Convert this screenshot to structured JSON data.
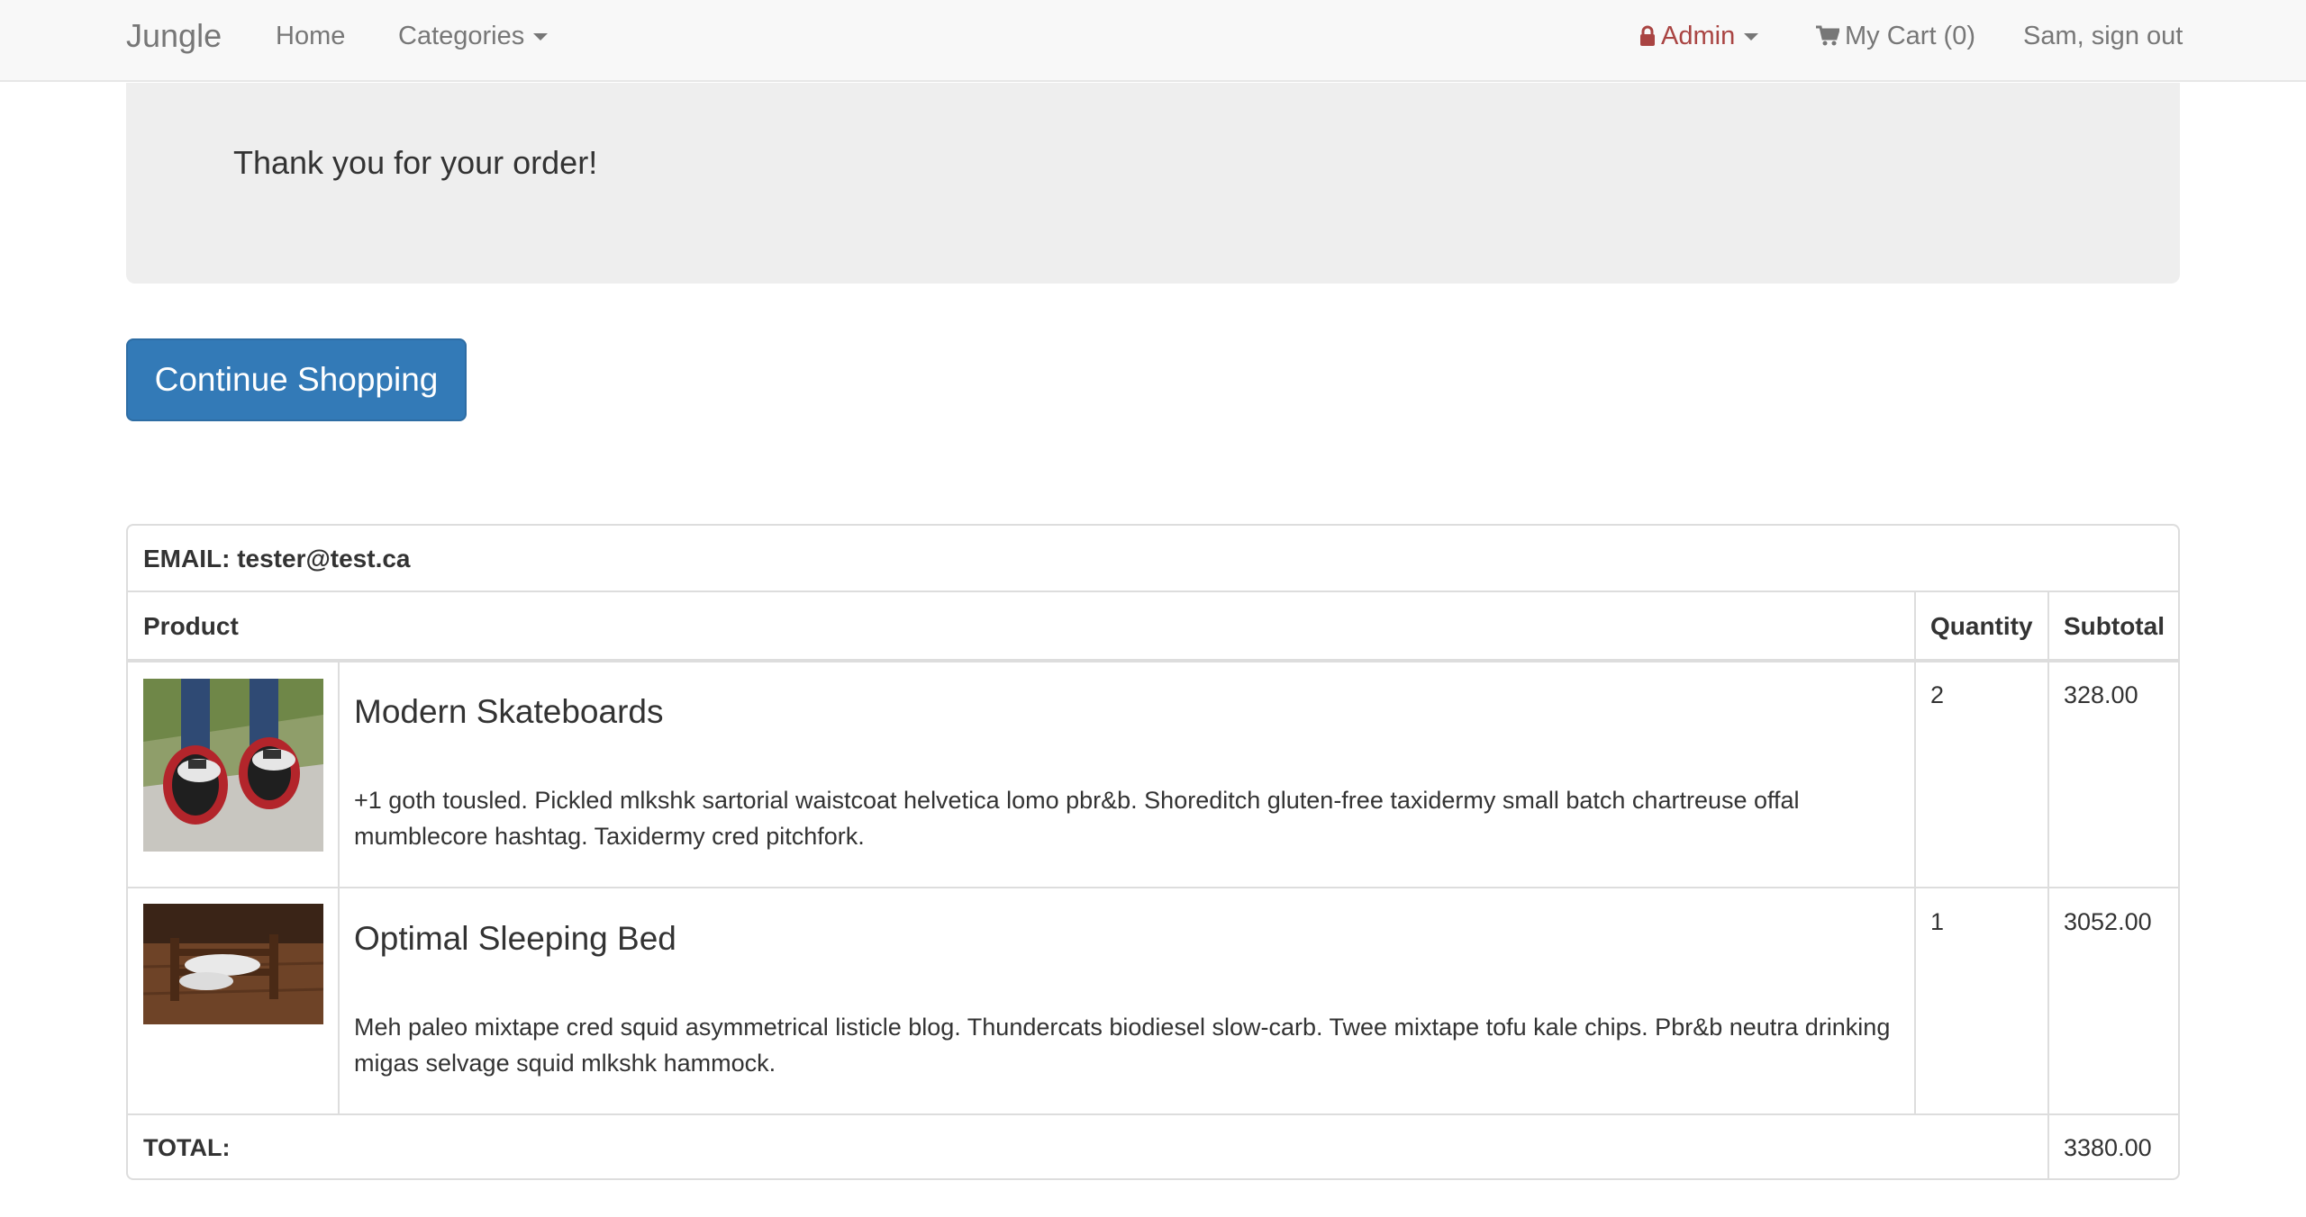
{
  "navbar": {
    "brand": "Jungle",
    "home": "Home",
    "categories": "Categories",
    "admin": "Admin",
    "cart": "My Cart (0)",
    "signout": "Sam, sign out"
  },
  "jumbotron": {
    "title": "Thank you for your order!"
  },
  "continue_button": "Continue Shopping",
  "order": {
    "email_label": "EMAIL: tester@test.ca",
    "headers": {
      "product": "Product",
      "quantity": "Quantity",
      "subtotal": "Subtotal"
    },
    "items": [
      {
        "name": "Modern Skateboards",
        "description": "+1 goth tousled. Pickled mlkshk sartorial waistcoat helvetica lomo pbr&b. Shoreditch gluten-free taxidermy small batch chartreuse offal mumblecore hashtag. Taxidermy cred pitchfork.",
        "quantity": "2",
        "subtotal": "328.00"
      },
      {
        "name": "Optimal Sleeping Bed",
        "description": "Meh paleo mixtape cred squid asymmetrical listicle blog. Thundercats biodiesel slow-carb. Twee mixtape tofu kale chips. Pbr&b neutra drinking migas selvage squid mlkshk hammock.",
        "quantity": "1",
        "subtotal": "3052.00"
      }
    ],
    "total_label": "TOTAL:",
    "total_value": "3380.00"
  },
  "colors": {
    "navbar_bg": "#f8f8f8",
    "admin_red": "#a94442",
    "button_blue": "#337ab7",
    "jumbotron_bg": "#eeeeee"
  },
  "icons": {
    "admin": "lock-icon",
    "cart": "shopping-cart-icon"
  }
}
